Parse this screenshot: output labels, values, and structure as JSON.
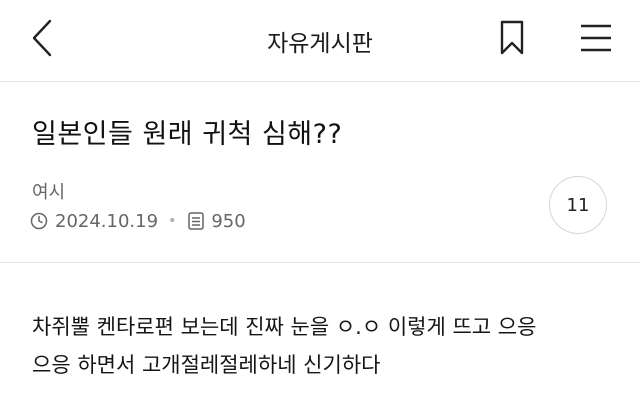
{
  "header": {
    "board_name": "자유게시판",
    "back_icon": "chevron-left-icon",
    "bookmark_icon": "bookmark-icon",
    "menu_icon": "hamburger-menu-icon"
  },
  "post": {
    "title": "일본인들 원래 귀척 심해??",
    "author": "여시",
    "date": "2024.10.19",
    "views": "950",
    "comment_count": "11",
    "body_lines": [
      "차쥐뿔 켄타로편 보는데 진짜 눈을 ㅇ.ㅇ 이렇게 뜨고 으응",
      "으응 하면서 고개절레절레하네 신기하다"
    ]
  },
  "colors": {
    "text": "#111111",
    "meta": "#666666",
    "divider": "#e6e6e6",
    "badge_border": "#d6d6d6"
  }
}
